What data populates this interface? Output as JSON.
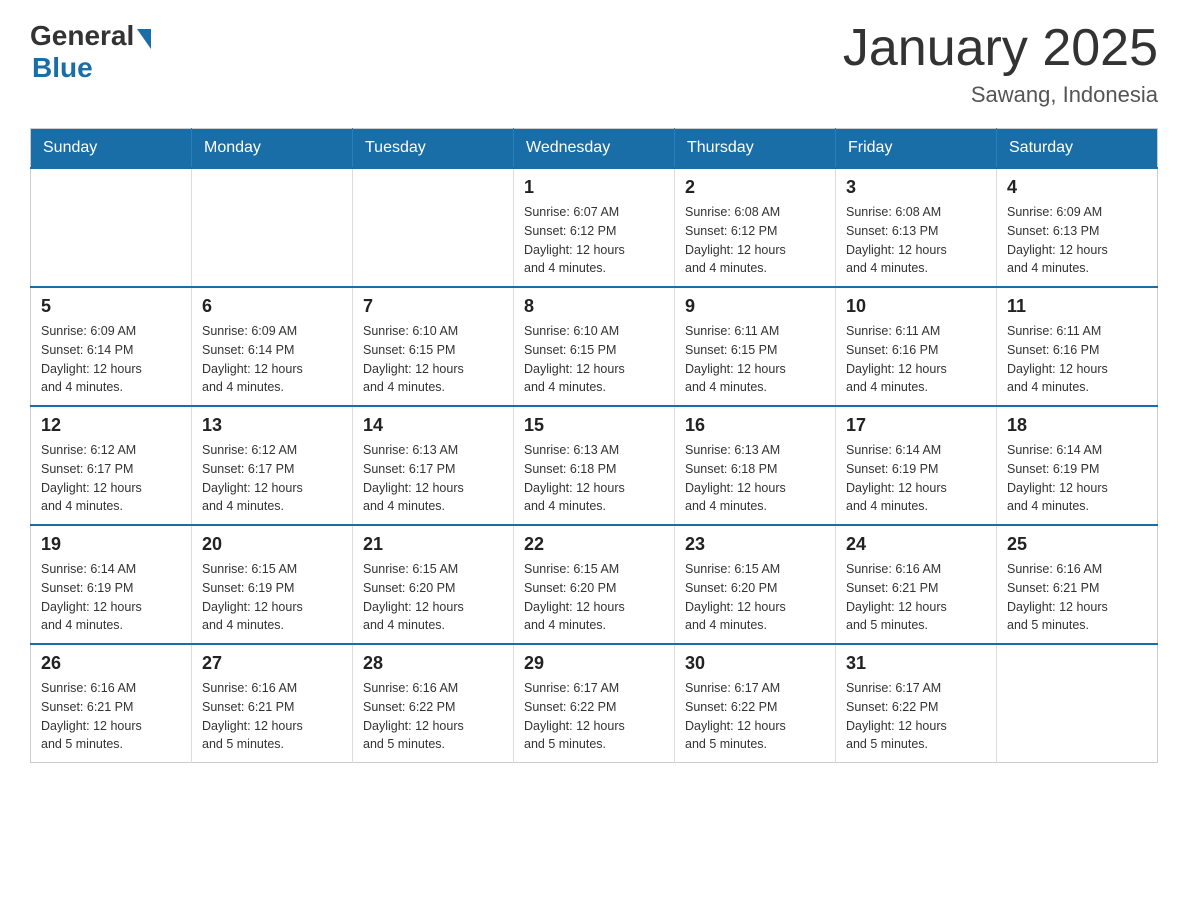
{
  "logo": {
    "general": "General",
    "blue": "Blue"
  },
  "title": "January 2025",
  "subtitle": "Sawang, Indonesia",
  "weekdays": [
    "Sunday",
    "Monday",
    "Tuesday",
    "Wednesday",
    "Thursday",
    "Friday",
    "Saturday"
  ],
  "weeks": [
    [
      {
        "day": "",
        "info": ""
      },
      {
        "day": "",
        "info": ""
      },
      {
        "day": "",
        "info": ""
      },
      {
        "day": "1",
        "info": "Sunrise: 6:07 AM\nSunset: 6:12 PM\nDaylight: 12 hours\nand 4 minutes."
      },
      {
        "day": "2",
        "info": "Sunrise: 6:08 AM\nSunset: 6:12 PM\nDaylight: 12 hours\nand 4 minutes."
      },
      {
        "day": "3",
        "info": "Sunrise: 6:08 AM\nSunset: 6:13 PM\nDaylight: 12 hours\nand 4 minutes."
      },
      {
        "day": "4",
        "info": "Sunrise: 6:09 AM\nSunset: 6:13 PM\nDaylight: 12 hours\nand 4 minutes."
      }
    ],
    [
      {
        "day": "5",
        "info": "Sunrise: 6:09 AM\nSunset: 6:14 PM\nDaylight: 12 hours\nand 4 minutes."
      },
      {
        "day": "6",
        "info": "Sunrise: 6:09 AM\nSunset: 6:14 PM\nDaylight: 12 hours\nand 4 minutes."
      },
      {
        "day": "7",
        "info": "Sunrise: 6:10 AM\nSunset: 6:15 PM\nDaylight: 12 hours\nand 4 minutes."
      },
      {
        "day": "8",
        "info": "Sunrise: 6:10 AM\nSunset: 6:15 PM\nDaylight: 12 hours\nand 4 minutes."
      },
      {
        "day": "9",
        "info": "Sunrise: 6:11 AM\nSunset: 6:15 PM\nDaylight: 12 hours\nand 4 minutes."
      },
      {
        "day": "10",
        "info": "Sunrise: 6:11 AM\nSunset: 6:16 PM\nDaylight: 12 hours\nand 4 minutes."
      },
      {
        "day": "11",
        "info": "Sunrise: 6:11 AM\nSunset: 6:16 PM\nDaylight: 12 hours\nand 4 minutes."
      }
    ],
    [
      {
        "day": "12",
        "info": "Sunrise: 6:12 AM\nSunset: 6:17 PM\nDaylight: 12 hours\nand 4 minutes."
      },
      {
        "day": "13",
        "info": "Sunrise: 6:12 AM\nSunset: 6:17 PM\nDaylight: 12 hours\nand 4 minutes."
      },
      {
        "day": "14",
        "info": "Sunrise: 6:13 AM\nSunset: 6:17 PM\nDaylight: 12 hours\nand 4 minutes."
      },
      {
        "day": "15",
        "info": "Sunrise: 6:13 AM\nSunset: 6:18 PM\nDaylight: 12 hours\nand 4 minutes."
      },
      {
        "day": "16",
        "info": "Sunrise: 6:13 AM\nSunset: 6:18 PM\nDaylight: 12 hours\nand 4 minutes."
      },
      {
        "day": "17",
        "info": "Sunrise: 6:14 AM\nSunset: 6:19 PM\nDaylight: 12 hours\nand 4 minutes."
      },
      {
        "day": "18",
        "info": "Sunrise: 6:14 AM\nSunset: 6:19 PM\nDaylight: 12 hours\nand 4 minutes."
      }
    ],
    [
      {
        "day": "19",
        "info": "Sunrise: 6:14 AM\nSunset: 6:19 PM\nDaylight: 12 hours\nand 4 minutes."
      },
      {
        "day": "20",
        "info": "Sunrise: 6:15 AM\nSunset: 6:19 PM\nDaylight: 12 hours\nand 4 minutes."
      },
      {
        "day": "21",
        "info": "Sunrise: 6:15 AM\nSunset: 6:20 PM\nDaylight: 12 hours\nand 4 minutes."
      },
      {
        "day": "22",
        "info": "Sunrise: 6:15 AM\nSunset: 6:20 PM\nDaylight: 12 hours\nand 4 minutes."
      },
      {
        "day": "23",
        "info": "Sunrise: 6:15 AM\nSunset: 6:20 PM\nDaylight: 12 hours\nand 4 minutes."
      },
      {
        "day": "24",
        "info": "Sunrise: 6:16 AM\nSunset: 6:21 PM\nDaylight: 12 hours\nand 5 minutes."
      },
      {
        "day": "25",
        "info": "Sunrise: 6:16 AM\nSunset: 6:21 PM\nDaylight: 12 hours\nand 5 minutes."
      }
    ],
    [
      {
        "day": "26",
        "info": "Sunrise: 6:16 AM\nSunset: 6:21 PM\nDaylight: 12 hours\nand 5 minutes."
      },
      {
        "day": "27",
        "info": "Sunrise: 6:16 AM\nSunset: 6:21 PM\nDaylight: 12 hours\nand 5 minutes."
      },
      {
        "day": "28",
        "info": "Sunrise: 6:16 AM\nSunset: 6:22 PM\nDaylight: 12 hours\nand 5 minutes."
      },
      {
        "day": "29",
        "info": "Sunrise: 6:17 AM\nSunset: 6:22 PM\nDaylight: 12 hours\nand 5 minutes."
      },
      {
        "day": "30",
        "info": "Sunrise: 6:17 AM\nSunset: 6:22 PM\nDaylight: 12 hours\nand 5 minutes."
      },
      {
        "day": "31",
        "info": "Sunrise: 6:17 AM\nSunset: 6:22 PM\nDaylight: 12 hours\nand 5 minutes."
      },
      {
        "day": "",
        "info": ""
      }
    ]
  ]
}
